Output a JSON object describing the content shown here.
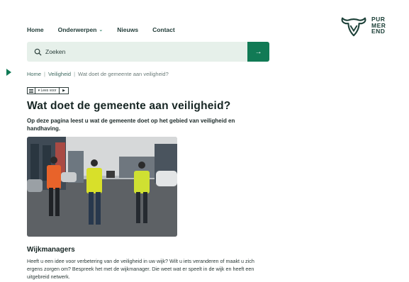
{
  "nav": {
    "items": [
      {
        "label": "Home"
      },
      {
        "label": "Onderwerpen",
        "dropdown": true
      },
      {
        "label": "Nieuws"
      },
      {
        "label": "Contact"
      }
    ]
  },
  "logo": {
    "line1": "PUR",
    "line2": "MER",
    "line3": "END"
  },
  "search": {
    "placeholder": "Zoeken",
    "submit_icon": "arrow-right-icon"
  },
  "breadcrumb": {
    "home": "Home",
    "section": "Veiligheid",
    "current": "Wat doet de gemeente aan veiligheid?"
  },
  "readspeaker": {
    "label": "Lees voor"
  },
  "page": {
    "title": "Wat doet de gemeente aan veiligheid?",
    "intro": "Op deze pagina leest u wat de gemeente doet op het gebied van veiligheid en handhaving.",
    "section_title": "Wijkmanagers",
    "section_text": "Heeft u een idee voor verbetering van de veiligheid in uw wijk? Wilt u iets veranderen of maakt u zich ergens zorgen om? Bespreek het met de wijkmanager. Die weet wat er speelt in de wijk en heeft een uitgebreid netwerk."
  },
  "colors": {
    "brand_green": "#117a55",
    "search_bg": "#e6f0ea"
  }
}
